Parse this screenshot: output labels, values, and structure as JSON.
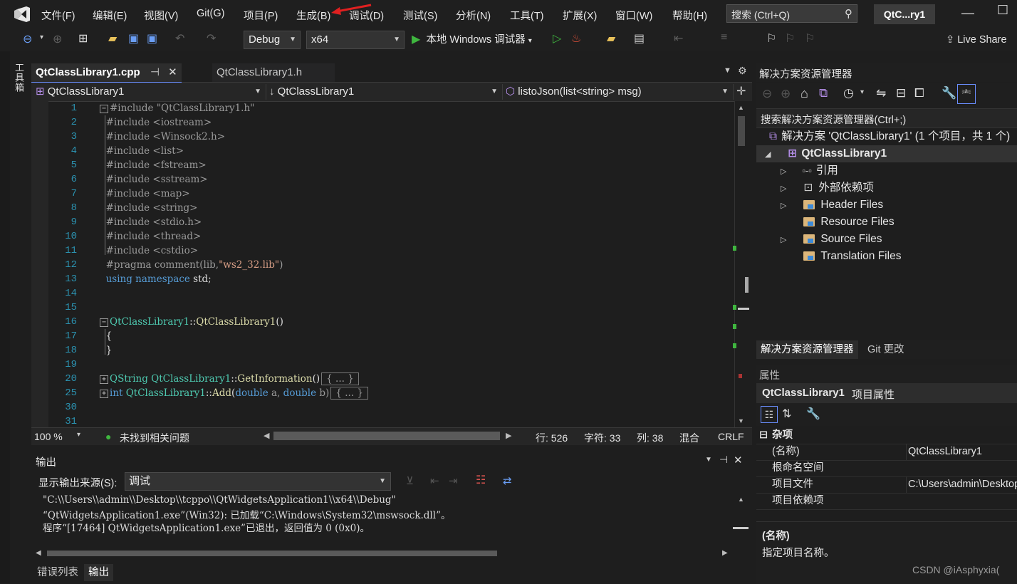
{
  "menubar": {
    "items": [
      "文件(F)",
      "编辑(E)",
      "视图(V)",
      "Git(G)",
      "项目(P)",
      "生成(B)",
      "调试(D)",
      "测试(S)",
      "分析(N)",
      "工具(T)",
      "扩展(X)",
      "窗口(W)",
      "帮助(H)"
    ],
    "search_label": "搜索 (Ctrl+Q)",
    "title": "QtC...ry1"
  },
  "toolbar": {
    "config": "Debug",
    "platform": "x64",
    "run_label": "本地 Windows 调试器",
    "live_share": "Live Share"
  },
  "sidebar": {
    "toolbox": "工具箱"
  },
  "editor": {
    "tabs": [
      {
        "label": "QtClassLibrary1.cpp",
        "active": true
      },
      {
        "label": "QtClassLibrary1.h",
        "active": false
      }
    ],
    "nav": {
      "project": "QtClassLibrary1",
      "scope": "QtClassLibrary1",
      "member": "listoJson(list<string> msg)"
    },
    "line_numbers": [
      "1",
      "2",
      "3",
      "4",
      "5",
      "6",
      "7",
      "8",
      "9",
      "10",
      "11",
      "12",
      "13",
      "14",
      "15",
      "16",
      "17",
      "18",
      "19",
      "20",
      "25",
      "30",
      "31"
    ],
    "code": {
      "l1": "#include \"QtClassLibrary1.h\"",
      "l2": "#include <iostream>",
      "l3": "#include <Winsock2.h>",
      "l4": "#include <list>",
      "l5": "#include <fstream>",
      "l6": "#include <sstream>",
      "l7": "#include <map>",
      "l8": "#include <string>",
      "l9": "#include <stdio.h>",
      "l10": "#include <thread>",
      "l11": "#include <cstdio>",
      "l12a": "#pragma comment(lib,",
      "l12b": "\"ws2_32.lib\"",
      "l12c": ")",
      "l13a": "using",
      "l13b": "namespace",
      "l13c": "std;",
      "l16a": "QtClassLibrary1",
      "l16b": "::",
      "l16c": "QtClassLibrary1",
      "l16d": "()",
      "l17": "{",
      "l18": "}",
      "l20a": "QString",
      "l20b": "QtClassLibrary1",
      "l20c": "::",
      "l20d": "GetInformation",
      "l20e": "()",
      "l25a": "int",
      "l25b": "QtClassLibrary1",
      "l25c": "::",
      "l25d": "Add",
      "l25e": "(",
      "l25f": "double",
      "l25g": "a,",
      "l25h": "double",
      "l25i": "b)",
      "collapsed": "{ ... }"
    },
    "status": {
      "zoom": "100 %",
      "issues": "未找到相关问题",
      "line": "行: 526",
      "char": "字符: 33",
      "col": "列: 38",
      "indent": "混合",
      "eol": "CRLF"
    }
  },
  "output": {
    "title": "输出",
    "source_label": "显示输出来源(S):",
    "source_value": "调试",
    "lines": [
      "\"C:\\\\Users\\\\admin\\\\Desktop\\\\tcppo\\\\QtWidgetsApplication1\\\\x64\\\\Debug\"",
      "“QtWidgetsApplication1.exe”(Win32): 已加载“C:\\Windows\\System32\\mswsock.dll”。",
      "程序“[17464] QtWidgetsApplication1.exe”已退出，返回值为 0 (0x0)。"
    ],
    "bottom_tabs": [
      "错误列表",
      "输出"
    ]
  },
  "solution_explorer": {
    "title": "解决方案资源管理器",
    "search": "搜索解决方案资源管理器(Ctrl+;)",
    "solution": "解决方案 'QtClassLibrary1' (1 个项目，共 1 个)",
    "project": "QtClassLibrary1",
    "items": [
      "引用",
      "外部依赖项",
      "Header Files",
      "Resource Files",
      "Source Files",
      "Translation Files"
    ],
    "tabs": [
      "解决方案资源管理器",
      "Git 更改"
    ]
  },
  "properties": {
    "title": "属性",
    "object": "QtClassLibrary1",
    "object_type": "项目属性",
    "category": "杂项",
    "rows": [
      {
        "key": "(名称)",
        "value": "QtClassLibrary1"
      },
      {
        "key": "根命名空间",
        "value": ""
      },
      {
        "key": "项目文件",
        "value": "C:\\Users\\admin\\Desktop"
      },
      {
        "key": "项目依赖项",
        "value": ""
      }
    ],
    "desc_title": "(名称)",
    "desc_text": "指定项目名称。"
  },
  "watermark": "CSDN @iAsphyxia(",
  "colors": {
    "accent": "#6a8eff",
    "keyword": "#569cd6",
    "string": "#d69d85",
    "class": "#4ec9b0",
    "arrow": "#e02020"
  }
}
